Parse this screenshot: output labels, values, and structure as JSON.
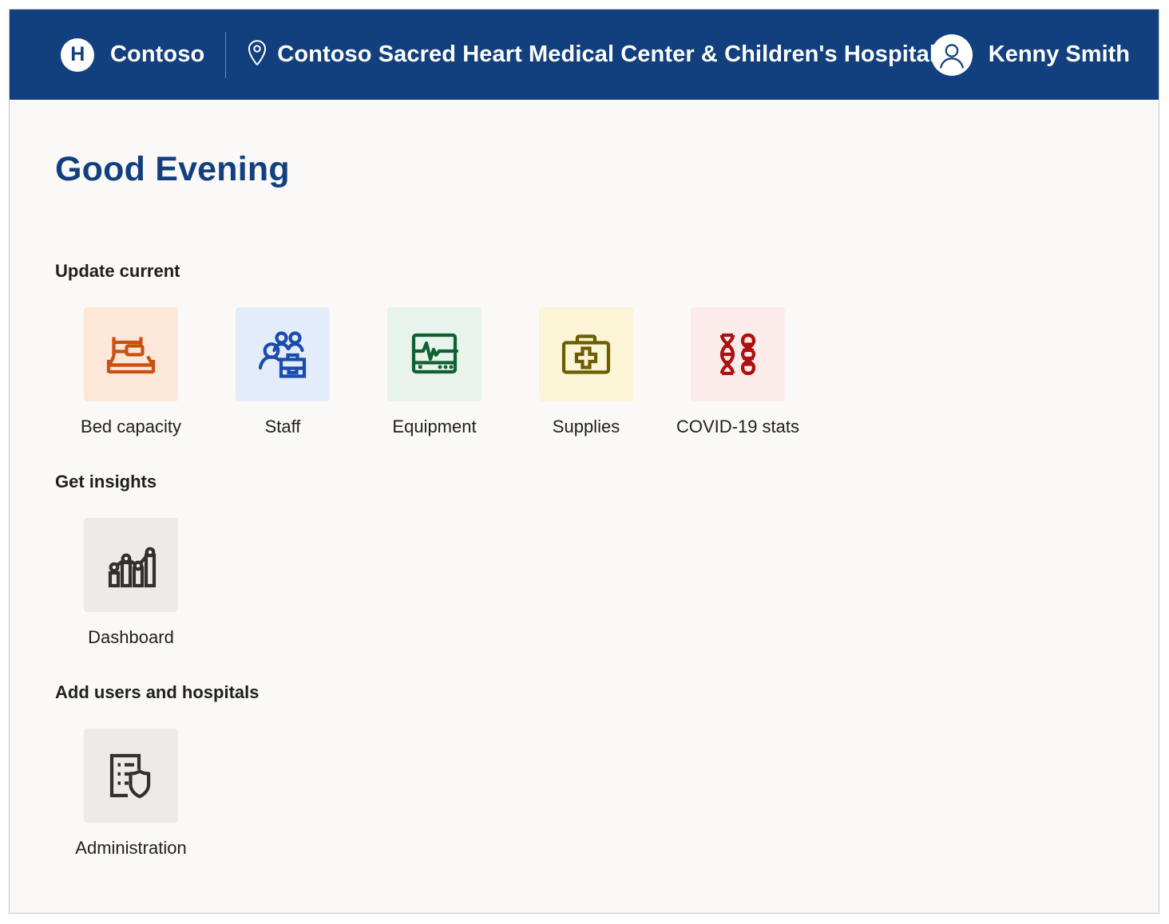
{
  "header": {
    "logo_letter": "H",
    "brand_name": "Contoso",
    "location_icon": "map-pin-icon",
    "site_name": "Contoso Sacred Heart Medical Center & Children's Hospital",
    "user_name": "Kenny Smith",
    "avatar_icon": "person-icon",
    "background_color": "#12407f"
  },
  "page": {
    "greeting": "Good Evening",
    "greeting_color": "#12407f",
    "background_color": "#faf9f7"
  },
  "sections": [
    {
      "title": "Update current",
      "tiles": [
        {
          "label": "Bed capacity",
          "icon": "bed-icon",
          "icon_color": "#CA5010",
          "tile_color": "#FDE7D9"
        },
        {
          "label": "Staff",
          "icon": "people-briefcase-icon",
          "icon_color": "#1A4BAD",
          "tile_color": "#E3ECFB"
        },
        {
          "label": "Equipment",
          "icon": "ecg-monitor-icon",
          "icon_color": "#0E6130",
          "tile_color": "#E8F3EC"
        },
        {
          "label": "Supplies",
          "icon": "first-aid-kit-icon",
          "icon_color": "#6B5D00",
          "tile_color": "#FCF4D6"
        },
        {
          "label": "COVID-19 stats",
          "icon": "dna-helix-icon",
          "icon_color": "#AD1010",
          "tile_color": "#FBECEB"
        }
      ]
    },
    {
      "title": "Get insights",
      "tiles": [
        {
          "label": "Dashboard",
          "icon": "bar-chart-line-icon",
          "icon_color": "#323130",
          "tile_color": "#EDEBE9"
        }
      ]
    },
    {
      "title": "Add users and hospitals",
      "tiles": [
        {
          "label": "Administration",
          "icon": "document-shield-icon",
          "icon_color": "#323130",
          "tile_color": "#EDEBE9"
        }
      ]
    }
  ]
}
